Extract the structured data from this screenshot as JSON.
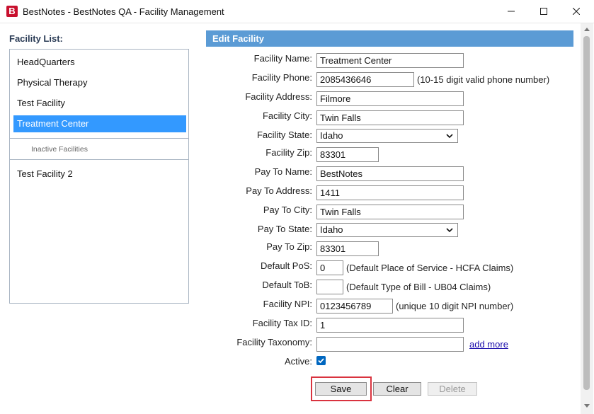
{
  "window": {
    "title": "BestNotes - BestNotes QA - Facility Management",
    "logo_letter": "B"
  },
  "facility_list": {
    "label": "Facility List:",
    "active_items": [
      "HeadQuarters",
      "Physical Therapy",
      "Test Facility",
      "Treatment Center"
    ],
    "selected": "Treatment Center",
    "inactive_label": "Inactive Facilities",
    "inactive_items": [
      "Test Facility 2"
    ]
  },
  "edit": {
    "header": "Edit Facility",
    "fields": {
      "facility_name": {
        "label": "Facility Name:",
        "value": "Treatment Center"
      },
      "facility_phone": {
        "label": "Facility Phone:",
        "value": "2085436646",
        "hint": "(10-15 digit valid phone number)"
      },
      "facility_address": {
        "label": "Facility Address:",
        "value": "Filmore"
      },
      "facility_city": {
        "label": "Facility City:",
        "value": "Twin Falls"
      },
      "facility_state": {
        "label": "Facility State:",
        "value": "Idaho"
      },
      "facility_zip": {
        "label": "Facility Zip:",
        "value": "83301"
      },
      "pay_to_name": {
        "label": "Pay To Name:",
        "value": "BestNotes"
      },
      "pay_to_address": {
        "label": "Pay To Address:",
        "value": "1411"
      },
      "pay_to_city": {
        "label": "Pay To City:",
        "value": "Twin Falls"
      },
      "pay_to_state": {
        "label": "Pay To State:",
        "value": "Idaho"
      },
      "pay_to_zip": {
        "label": "Pay To Zip:",
        "value": "83301"
      },
      "default_pos": {
        "label": "Default PoS:",
        "value": "0",
        "hint": "(Default Place of Service - HCFA Claims)"
      },
      "default_tob": {
        "label": "Default ToB:",
        "value": "",
        "hint": "(Default Type of Bill - UB04 Claims)"
      },
      "facility_npi": {
        "label": "Facility NPI:",
        "value": "0123456789",
        "hint": "(unique 10 digit NPI number)"
      },
      "facility_tax_id": {
        "label": "Facility Tax ID:",
        "value": "1"
      },
      "facility_taxonomy": {
        "label": "Facility Taxonomy:",
        "value": "",
        "link": "add more"
      },
      "active": {
        "label": "Active:",
        "checked": true
      }
    },
    "buttons": {
      "save": "Save",
      "clear": "Clear",
      "delete": "Delete"
    }
  },
  "colors": {
    "header_blue": "#5b9bd5",
    "selected_blue": "#3399ff",
    "highlight_red": "#d9333f",
    "logo_red": "#c8102e"
  }
}
